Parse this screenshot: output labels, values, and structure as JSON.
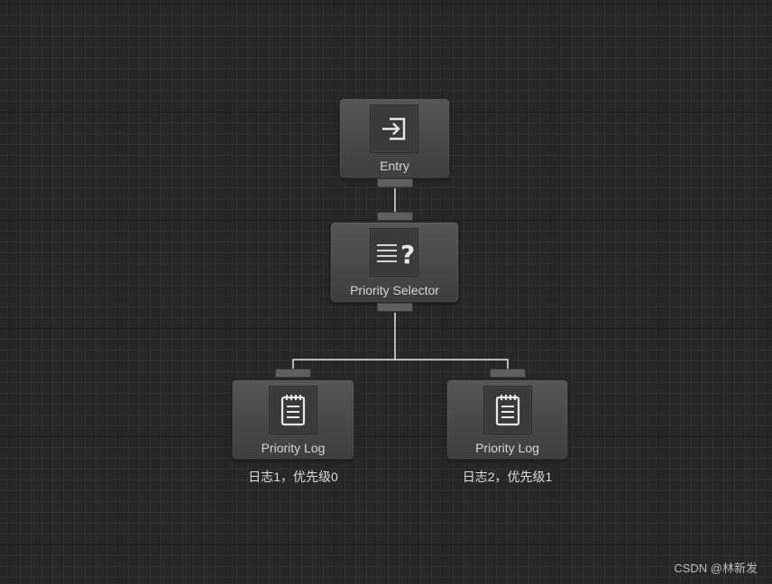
{
  "graph": {
    "nodes": [
      {
        "id": "entry",
        "title": "Entry",
        "icon": "entry-arrow-icon",
        "comment": ""
      },
      {
        "id": "selector",
        "title": "Priority Selector",
        "icon": "priority-selector-icon",
        "comment": ""
      },
      {
        "id": "log1",
        "title": "Priority Log",
        "icon": "notepad-icon",
        "comment": "日志1，优先级0"
      },
      {
        "id": "log2",
        "title": "Priority Log",
        "icon": "notepad-icon",
        "comment": "日志2，优先级1"
      }
    ],
    "edges": [
      {
        "from": "entry",
        "to": "selector"
      },
      {
        "from": "selector",
        "to": "log1"
      },
      {
        "from": "selector",
        "to": "log2"
      }
    ]
  },
  "watermark": "CSDN @林新发",
  "colors": {
    "background": "#272727",
    "node": "#4a4a4a",
    "wire": "#e6e6e6",
    "text": "#d6d6d6"
  }
}
